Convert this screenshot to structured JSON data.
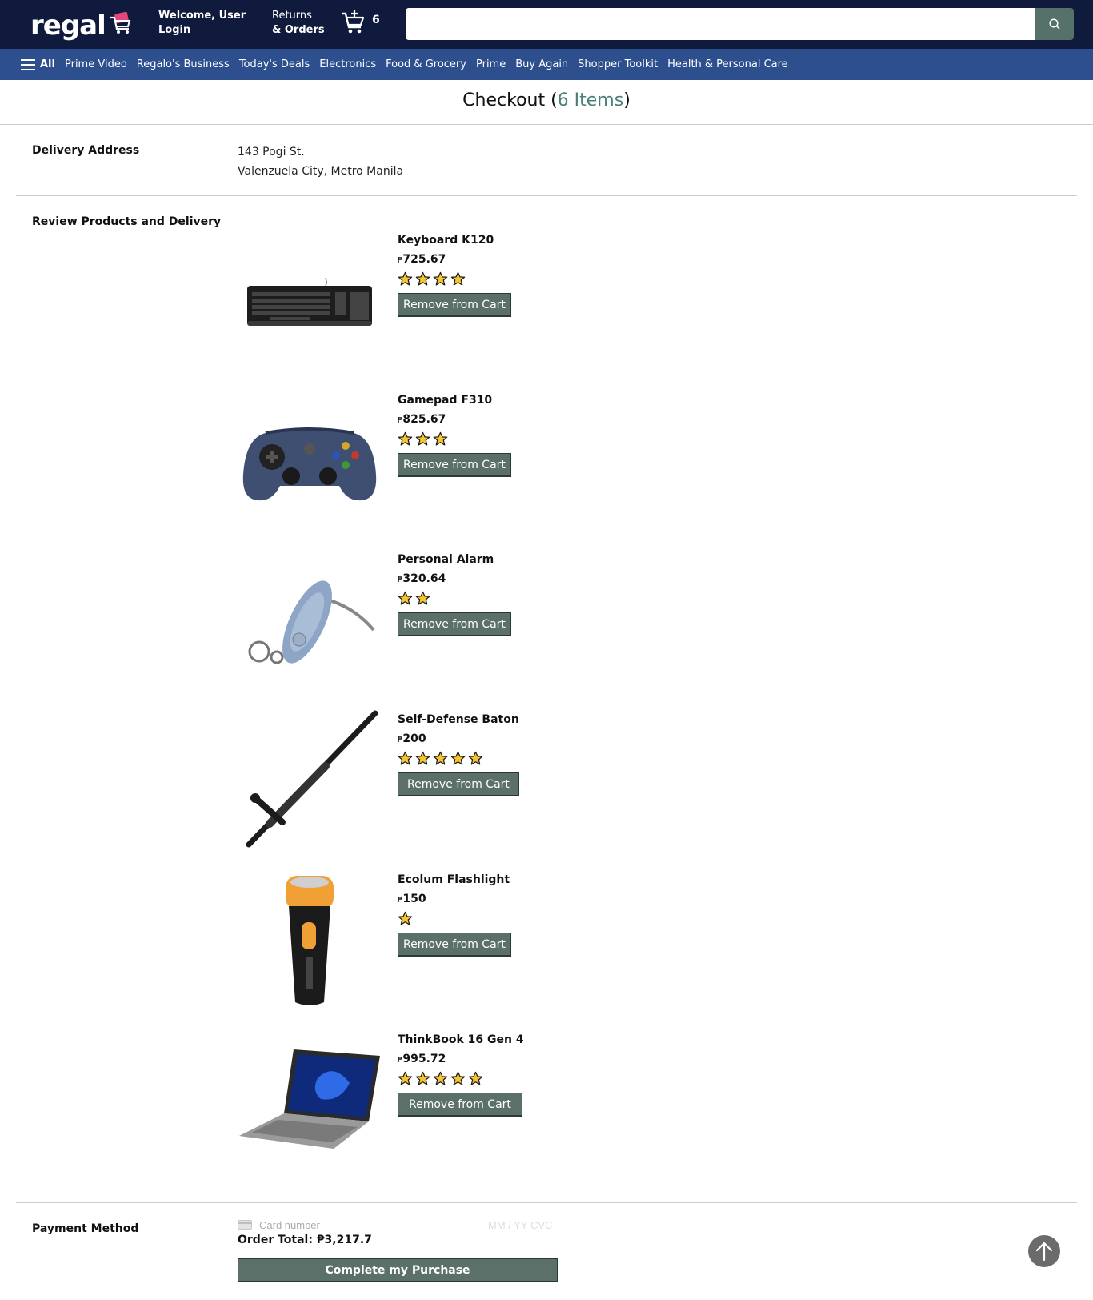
{
  "header": {
    "logo_text": "regal",
    "welcome_line1": "Welcome, User",
    "welcome_line2": "Login",
    "returns_line1": "Returns",
    "returns_line2": "& Orders",
    "cart_count": "6",
    "search_placeholder": "",
    "colors": {
      "topbar": "#0f1a3d",
      "navbar": "#2e4f8e",
      "accent": "#56706a"
    }
  },
  "nav": {
    "all_label": "All",
    "items": [
      "Prime Video",
      "Regalo's Business",
      "Today's Deals",
      "Electronics",
      "Food & Grocery",
      "Prime",
      "Buy Again",
      "Shopper Toolkit",
      "Health & Personal Care"
    ]
  },
  "checkout": {
    "title_prefix": "Checkout (",
    "item_count": "6 Items",
    "title_suffix": ")"
  },
  "delivery": {
    "label": "Delivery Address",
    "line1": "143 Pogi St.",
    "line2": "Valenzuela City, Metro Manila"
  },
  "review": {
    "label": "Review Products and Delivery",
    "remove_label": "Remove from Cart",
    "products": [
      {
        "name": "Keyboard K120",
        "currency": "₱",
        "price": "725.67",
        "rating": 4,
        "image": "keyboard-image"
      },
      {
        "name": "Gamepad F310",
        "currency": "₱",
        "price": "825.67",
        "rating": 3,
        "image": "gamepad-image"
      },
      {
        "name": "Personal Alarm",
        "currency": "₱",
        "price": "320.64",
        "rating": 2,
        "image": "alarm-image"
      },
      {
        "name": "Self-Defense Baton",
        "currency": "₱",
        "price": "200",
        "rating": 5,
        "image": "baton-image"
      },
      {
        "name": "Ecolum Flashlight",
        "currency": "₱",
        "price": "150",
        "rating": 1,
        "image": "flashlight-image"
      },
      {
        "name": "ThinkBook 16 Gen 4",
        "currency": "₱",
        "price": "995.72",
        "rating": 5,
        "image": "laptop-image"
      }
    ]
  },
  "payment": {
    "label": "Payment Method",
    "card_placeholder": "Card number",
    "expiry_cvc_placeholder": "MM / YY  CVC",
    "order_total": "Order Total: ₱3,217.7",
    "complete_label": "Complete my Purchase"
  }
}
